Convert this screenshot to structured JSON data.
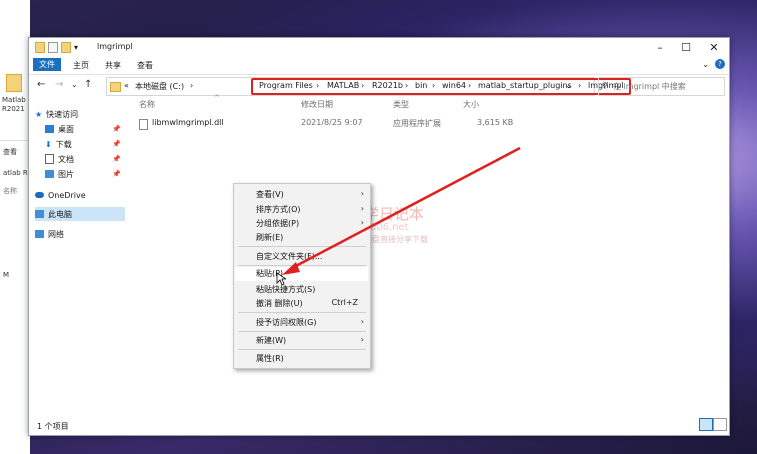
{
  "desktop": {
    "icon_label_1": "Matlab",
    "icon_label_2": "R2021"
  },
  "behind": {
    "tab": "查看",
    "path": "atlab R",
    "col": "名称",
    "item": "M"
  },
  "window": {
    "title": "lmgrimpl",
    "ribbon_tabs": [
      "文件",
      "主页",
      "共享",
      "查看"
    ],
    "nav_arrows": {
      "back": "←",
      "forward": "→",
      "down": "⌄",
      "up": "↑"
    },
    "address": {
      "prefix": "«",
      "drive": "本地磁盘 (C:)",
      "sep": "›",
      "crumbs": [
        "Program Files",
        "MATLAB",
        "R2021b",
        "bin",
        "win64",
        "matlab_startup_plugins",
        "lmgrimpl"
      ],
      "dropdown": "⌄",
      "refresh": "↻"
    },
    "search_placeholder": "在 lmgrimpl 中搜索",
    "nav_items": [
      {
        "label": "快速访问"
      },
      {
        "label": "桌面"
      },
      {
        "label": "下载"
      },
      {
        "label": "文档"
      },
      {
        "label": "图片"
      },
      {
        "label": "OneDrive"
      },
      {
        "label": "此电脑"
      },
      {
        "label": "网络"
      }
    ],
    "columns": {
      "name": "名称",
      "date": "修改日期",
      "type": "类型",
      "size": "大小"
    },
    "files": [
      {
        "name": "libmwlmgrimpl.dll",
        "date": "2021/8/25 9:07",
        "type": "应用程序扩展",
        "size": "3,615 KB"
      }
    ],
    "status": "1 个项目"
  },
  "context_menu": {
    "items": [
      {
        "label": "查看(V)",
        "submenu": true
      },
      {
        "label": "排序方式(O)",
        "submenu": true
      },
      {
        "label": "分组依据(P)",
        "submenu": true
      },
      {
        "label": "刷新(E)",
        "submenu": false
      },
      {
        "label": "自定义文件夹(F)...",
        "submenu": false
      },
      {
        "label": "粘贴(P)",
        "submenu": false
      },
      {
        "label": "粘贴快捷方式(S)",
        "submenu": false
      },
      {
        "label": "撤消 删除(U)",
        "submenu": false,
        "shortcut": "Ctrl+Z"
      },
      {
        "label": "授予访问权限(G)",
        "submenu": true
      },
      {
        "label": "新建(W)",
        "submenu": true
      },
      {
        "label": "属性(R)",
        "submenu": false
      }
    ]
  },
  "watermark": {
    "title": "丁丁学日记本",
    "url": "www.ts006.net",
    "tagline": "软件、资源、资料网盘直接分享下载"
  },
  "colors": {
    "accent": "#1a6fc1",
    "highlight": "#e01f1f",
    "selected": "#cce4f7"
  }
}
